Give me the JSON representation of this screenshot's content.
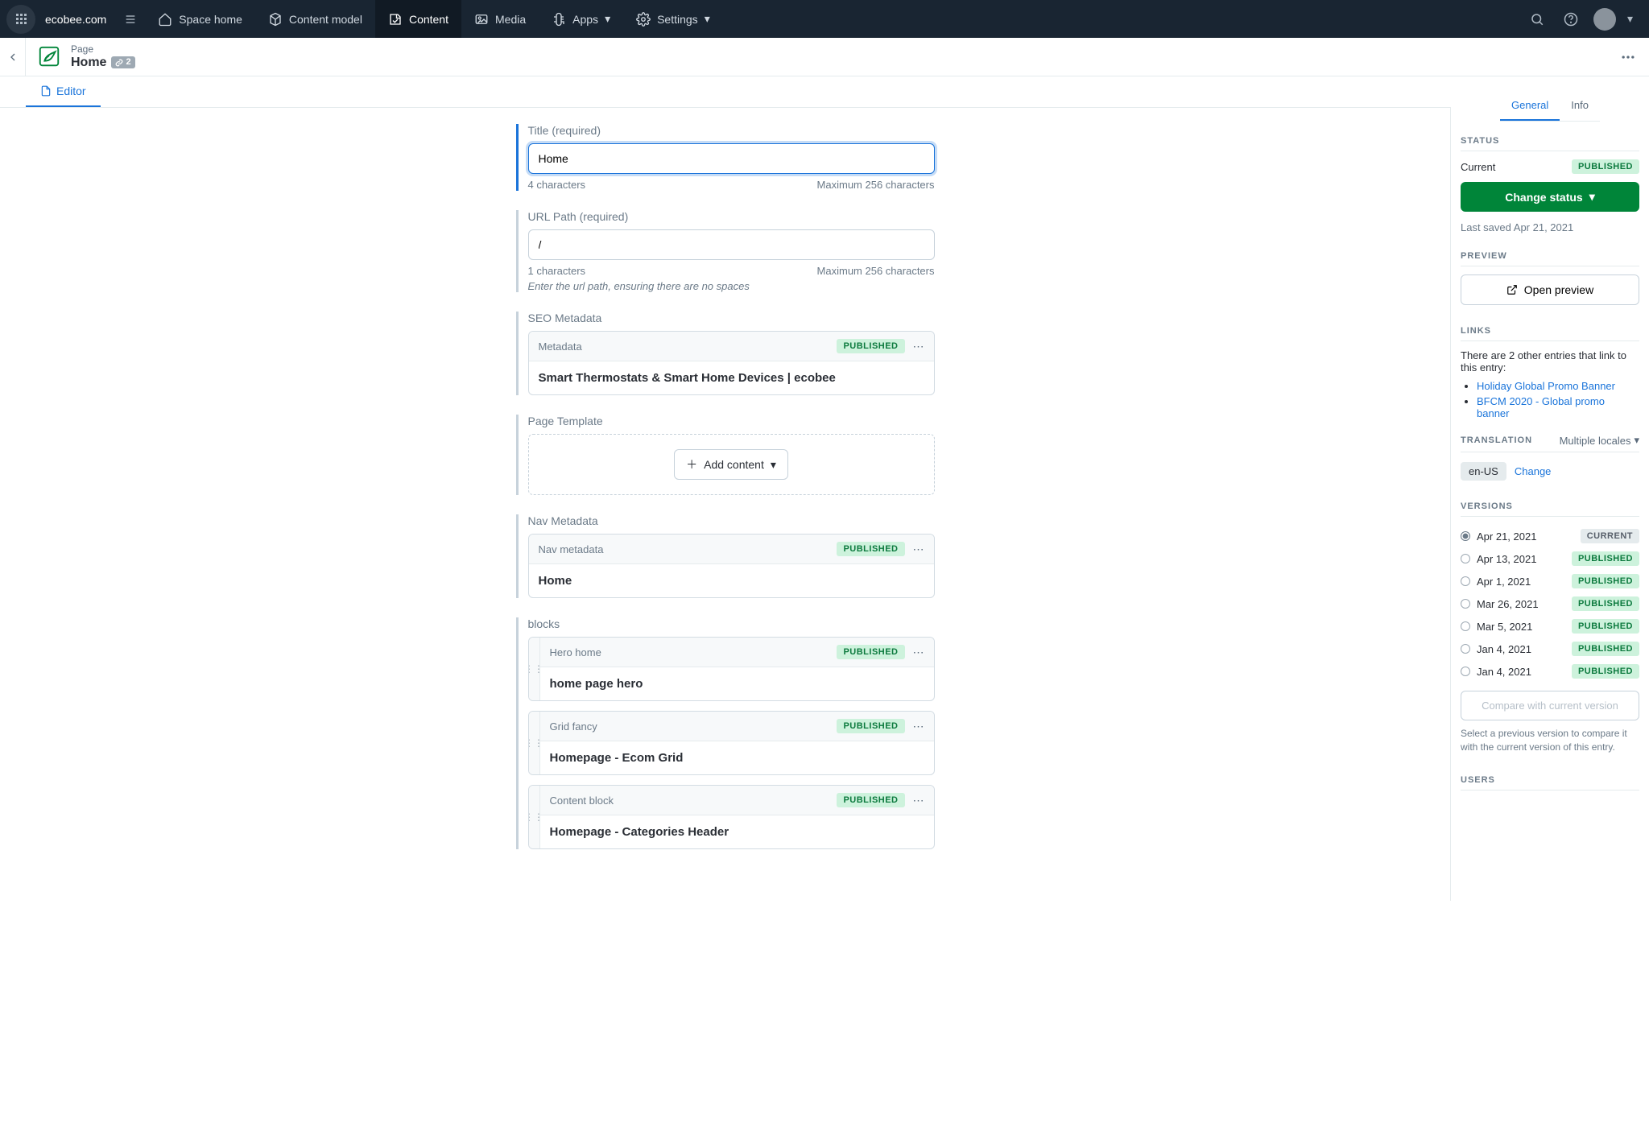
{
  "topbar": {
    "space": "ecobee.com",
    "nav": [
      {
        "label": "Space home"
      },
      {
        "label": "Content model"
      },
      {
        "label": "Content"
      },
      {
        "label": "Media"
      },
      {
        "label": "Apps"
      },
      {
        "label": "Settings"
      }
    ]
  },
  "entry": {
    "type": "Page",
    "title": "Home",
    "link_count": "2"
  },
  "tabs": {
    "editor": "Editor"
  },
  "fields": {
    "title": {
      "label": "Title (required)",
      "value": "Home",
      "count": "4 characters",
      "max": "Maximum 256 characters"
    },
    "url": {
      "label": "URL Path (required)",
      "value": "/",
      "count": "1 characters",
      "max": "Maximum 256 characters",
      "help": "Enter the url path, ensuring there are no spaces"
    },
    "seo": {
      "label": "SEO Metadata",
      "ref_name": "Metadata",
      "ref_title": "Smart Thermostats & Smart Home Devices | ecobee",
      "badge": "PUBLISHED"
    },
    "template": {
      "label": "Page Template",
      "add": "Add content"
    },
    "nav": {
      "label": "Nav Metadata",
      "ref_name": "Nav metadata",
      "ref_title": "Home",
      "badge": "PUBLISHED"
    },
    "blocks": {
      "label": "blocks",
      "items": [
        {
          "type": "Hero home",
          "title": "home page hero",
          "badge": "PUBLISHED"
        },
        {
          "type": "Grid fancy",
          "title": "Homepage - Ecom Grid",
          "badge": "PUBLISHED"
        },
        {
          "type": "Content block",
          "title": "Homepage - Categories Header",
          "badge": "PUBLISHED"
        }
      ]
    }
  },
  "sidebar": {
    "tabs": {
      "general": "General",
      "info": "Info"
    },
    "status": {
      "label": "STATUS",
      "current_label": "Current",
      "current_badge": "PUBLISHED",
      "change_btn": "Change status",
      "last_saved": "Last saved Apr 21, 2021"
    },
    "preview": {
      "label": "PREVIEW",
      "btn": "Open preview"
    },
    "links": {
      "label": "LINKS",
      "intro": "There are 2 other entries that link to this entry:",
      "items": [
        "Holiday Global Promo Banner",
        "BFCM 2020 - Global promo banner"
      ]
    },
    "translation": {
      "label": "TRANSLATION",
      "mode": "Multiple locales",
      "locale": "en-US",
      "change": "Change"
    },
    "versions": {
      "label": "VERSIONS",
      "items": [
        {
          "date": "Apr 21, 2021",
          "badge": "CURRENT",
          "selected": true
        },
        {
          "date": "Apr 13, 2021",
          "badge": "PUBLISHED"
        },
        {
          "date": "Apr 1, 2021",
          "badge": "PUBLISHED"
        },
        {
          "date": "Mar 26, 2021",
          "badge": "PUBLISHED"
        },
        {
          "date": "Mar 5, 2021",
          "badge": "PUBLISHED"
        },
        {
          "date": "Jan 4, 2021",
          "badge": "PUBLISHED"
        },
        {
          "date": "Jan 4, 2021",
          "badge": "PUBLISHED"
        }
      ],
      "compare": "Compare with current version",
      "help": "Select a previous version to compare it with the current version of this entry."
    },
    "users": {
      "label": "USERS"
    }
  }
}
